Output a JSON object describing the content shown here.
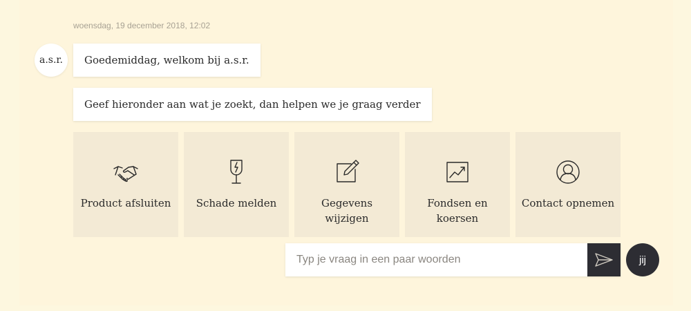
{
  "chat": {
    "timestamp": "woensdag, 19 december 2018, 12:02",
    "bot_avatar": "a.s.r.",
    "user_avatar": "jij",
    "messages": [
      "Goedemiddag, welkom bij a.s.r.",
      "Geef hieronder aan wat je zoekt, dan helpen we je graag verder"
    ]
  },
  "options": [
    {
      "label": "Product afsluiten",
      "icon": "handshake-icon"
    },
    {
      "label": "Schade melden",
      "icon": "broken-glass-icon"
    },
    {
      "label": "Gegevens wijzigen",
      "icon": "edit-icon"
    },
    {
      "label": "Fondsen en koersen",
      "icon": "chart-icon"
    },
    {
      "label": "Contact opnemen",
      "icon": "person-icon"
    }
  ],
  "input": {
    "placeholder": "Typ je vraag in een paar woorden",
    "value": ""
  },
  "colors": {
    "background": "#fdf7df",
    "tile": "#f3ead5",
    "dark": "#2d2d33",
    "text": "#2a2a2a"
  }
}
